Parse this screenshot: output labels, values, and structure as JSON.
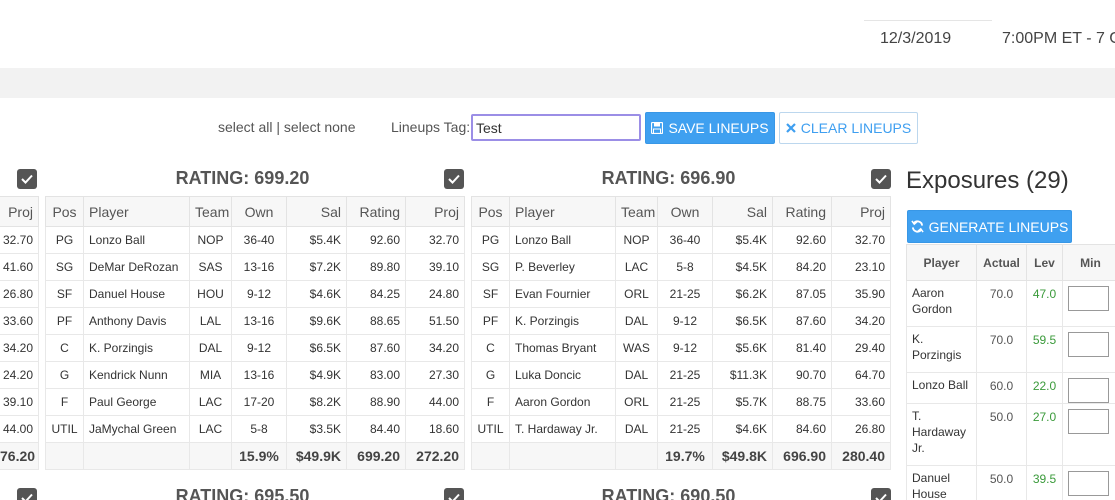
{
  "header": {
    "date": "12/3/2019",
    "time": "7:00PM ET - 7 G"
  },
  "toolbar": {
    "select_all": "select all",
    "separator": "|",
    "select_none": "select none",
    "lineups_tag_label": "Lineups Tag:",
    "lineups_tag_value": "Test",
    "save_label": "SAVE LINEUPS",
    "clear_label": "CLEAR LINEUPS"
  },
  "columns": [
    "Pos",
    "Player",
    "Team",
    "Own",
    "Sal",
    "Rating",
    "Proj"
  ],
  "partial_left": {
    "header": "Proj",
    "proj": [
      "32.70",
      "41.60",
      "26.80",
      "33.60",
      "34.20",
      "24.20",
      "39.10",
      "44.00"
    ],
    "total": "76.20"
  },
  "lineups": [
    {
      "rating_label": "RATING: 699.20",
      "rows": [
        {
          "pos": "PG",
          "player": "Lonzo Ball",
          "team": "NOP",
          "own": "36-40",
          "sal": "$5.4K",
          "rating": "92.60",
          "proj": "32.70"
        },
        {
          "pos": "SG",
          "player": "DeMar DeRozan",
          "team": "SAS",
          "own": "13-16",
          "sal": "$7.2K",
          "rating": "89.80",
          "proj": "39.10"
        },
        {
          "pos": "SF",
          "player": "Danuel House",
          "team": "HOU",
          "own": "9-12",
          "sal": "$4.6K",
          "rating": "84.25",
          "proj": "24.80"
        },
        {
          "pos": "PF",
          "player": "Anthony Davis",
          "team": "LAL",
          "own": "13-16",
          "sal": "$9.6K",
          "rating": "88.65",
          "proj": "51.50"
        },
        {
          "pos": "C",
          "player": "K. Porzingis",
          "team": "DAL",
          "own": "9-12",
          "sal": "$6.5K",
          "rating": "87.60",
          "proj": "34.20"
        },
        {
          "pos": "G",
          "player": "Kendrick Nunn",
          "team": "MIA",
          "own": "13-16",
          "sal": "$4.9K",
          "rating": "83.00",
          "proj": "27.30"
        },
        {
          "pos": "F",
          "player": "Paul George",
          "team": "LAC",
          "own": "17-20",
          "sal": "$8.2K",
          "rating": "88.90",
          "proj": "44.00"
        },
        {
          "pos": "UTIL",
          "player": "JaMychal Green",
          "team": "LAC",
          "own": "5-8",
          "sal": "$3.5K",
          "rating": "84.40",
          "proj": "18.60"
        }
      ],
      "totals": {
        "own": "15.9%",
        "sal": "$49.9K",
        "rating": "699.20",
        "proj": "272.20"
      }
    },
    {
      "rating_label": "RATING: 696.90",
      "rows": [
        {
          "pos": "PG",
          "player": "Lonzo Ball",
          "team": "NOP",
          "own": "36-40",
          "sal": "$5.4K",
          "rating": "92.60",
          "proj": "32.70"
        },
        {
          "pos": "SG",
          "player": "P. Beverley",
          "team": "LAC",
          "own": "5-8",
          "sal": "$4.5K",
          "rating": "84.20",
          "proj": "23.10"
        },
        {
          "pos": "SF",
          "player": "Evan Fournier",
          "team": "ORL",
          "own": "21-25",
          "sal": "$6.2K",
          "rating": "87.05",
          "proj": "35.90"
        },
        {
          "pos": "PF",
          "player": "K. Porzingis",
          "team": "DAL",
          "own": "9-12",
          "sal": "$6.5K",
          "rating": "87.60",
          "proj": "34.20"
        },
        {
          "pos": "C",
          "player": "Thomas Bryant",
          "team": "WAS",
          "own": "9-12",
          "sal": "$5.6K",
          "rating": "81.40",
          "proj": "29.40"
        },
        {
          "pos": "G",
          "player": "Luka Doncic",
          "team": "DAL",
          "own": "21-25",
          "sal": "$11.3K",
          "rating": "90.70",
          "proj": "64.70"
        },
        {
          "pos": "F",
          "player": "Aaron Gordon",
          "team": "ORL",
          "own": "21-25",
          "sal": "$5.7K",
          "rating": "88.75",
          "proj": "33.60"
        },
        {
          "pos": "UTIL",
          "player": "T. Hardaway Jr.",
          "team": "DAL",
          "own": "21-25",
          "sal": "$4.6K",
          "rating": "84.60",
          "proj": "26.80"
        }
      ],
      "totals": {
        "own": "19.7%",
        "sal": "$49.8K",
        "rating": "696.90",
        "proj": "280.40"
      }
    }
  ],
  "next_ratings": [
    "RATING: 695.50",
    "RATING: 690.50"
  ],
  "exposures": {
    "title": "Exposures (29)",
    "generate_label": "GENERATE LINEUPS",
    "columns": [
      "Player",
      "Actual",
      "Lev",
      "Min"
    ],
    "rows": [
      {
        "player": "Aaron Gordon",
        "actual": "70.0",
        "lev": "47.0"
      },
      {
        "player": "K. Porzingis",
        "actual": "70.0",
        "lev": "59.5"
      },
      {
        "player": "Lonzo Ball",
        "actual": "60.0",
        "lev": "22.0"
      },
      {
        "player": "T. Hardaway Jr.",
        "actual": "50.0",
        "lev": "27.0"
      },
      {
        "player": "Danuel House",
        "actual": "50.0",
        "lev": "39.5"
      }
    ]
  },
  "colors": {
    "accent": "#3fa0f0",
    "positive": "#3a9a3a",
    "checkbox": "#555555"
  }
}
